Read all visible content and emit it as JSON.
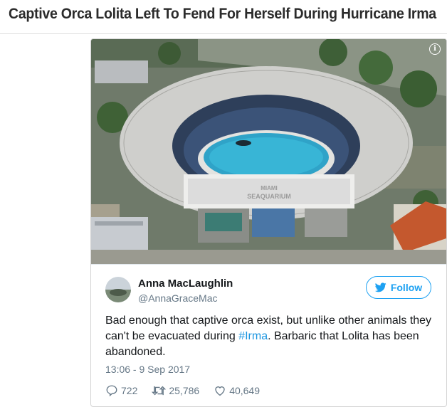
{
  "article": {
    "headline": "Captive Orca Lolita Left To Fend For Herself During Hurricane Irma"
  },
  "photo": {
    "stadium_sign": [
      "MIAMI",
      "SEAQUARIUM"
    ],
    "info_icon": "info-icon"
  },
  "tweet": {
    "author_name": "Anna MacLaughlin",
    "author_handle": "@AnnaGraceMac",
    "follow_label": "Follow",
    "text_before": "Bad enough that captive orca exist, but unlike other animals they can't be evacuated during ",
    "hashtag": "#Irma",
    "text_after": ". Barbaric that Lolita has been abandoned.",
    "timestamp": "13:06 - 9 Sep 2017",
    "reply_count": "722",
    "retweet_count": "25,786",
    "like_count": "40,649"
  },
  "colors": {
    "accent": "#1da1f2",
    "hashtag": "#1b95e0",
    "muted": "#657786"
  }
}
